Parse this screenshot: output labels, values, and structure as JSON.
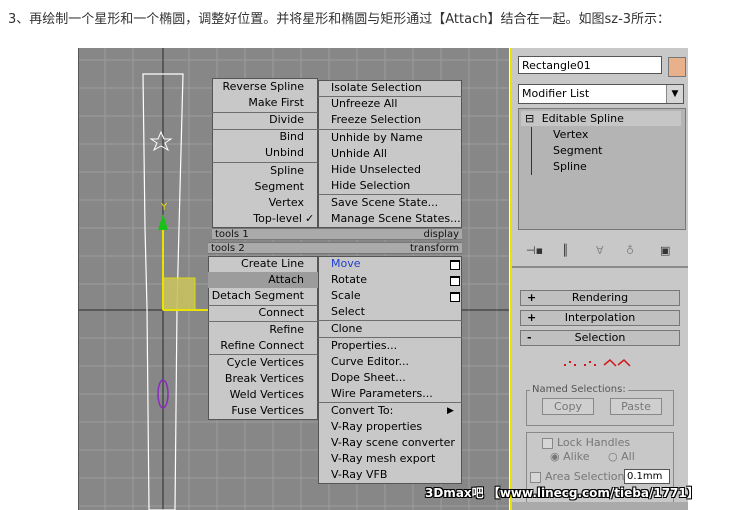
{
  "caption": "3、再绘制一个星形和一个椭圆，调整好位置。并将星形和椭圆与矩形通过【Attach】结合在一起。如图sz-3所示：",
  "viewport": {
    "axis_label": "Y"
  },
  "quad_left": {
    "header_tools1": "tools 1",
    "header_tools2": "tools 2",
    "items_top": [
      "Reverse Spline",
      "Make First",
      "Divide",
      "Bind",
      "Unbind",
      "Spline",
      "Segment",
      "Vertex",
      "Top-level"
    ],
    "items_bottom": [
      "Create Line",
      "Attach",
      "Detach Segment",
      "Connect",
      "Refine",
      "Refine Connect",
      "Cycle Vertices",
      "Break Vertices",
      "Weld Vertices",
      "Fuse Vertices"
    ],
    "checkmark": "✓"
  },
  "quad_right": {
    "header_display": "display",
    "header_transform": "transform",
    "items_top": [
      "Isolate Selection",
      "Unfreeze All",
      "Freeze Selection",
      "Unhide by Name",
      "Unhide All",
      "Hide Unselected",
      "Hide Selection",
      "Save Scene State...",
      "Manage Scene States..."
    ],
    "items_bottom": [
      "Move",
      "Rotate",
      "Scale",
      "Select",
      "Clone",
      "Properties...",
      "Curve Editor...",
      "Dope Sheet...",
      "Wire Parameters...",
      "Convert To:",
      "V-Ray properties",
      "V-Ray scene converter",
      "V-Ray mesh export",
      "V-Ray VFB"
    ]
  },
  "panel": {
    "object_name": "Rectangle01",
    "modifier_list": "Modifier List",
    "stack": {
      "root": "Editable Spline",
      "children": [
        "Vertex",
        "Segment",
        "Spline"
      ],
      "expander": "⊟"
    },
    "rollouts": [
      {
        "sign": "+",
        "label": "Rendering"
      },
      {
        "sign": "+",
        "label": "Interpolation"
      },
      {
        "sign": "-",
        "label": "Selection"
      }
    ],
    "named_selections": "Named Selections:",
    "copy": "Copy",
    "paste": "Paste",
    "lock_handles": "Lock Handles",
    "alike": "Alike",
    "all": "All",
    "area_selection": "Area Selection:",
    "area_value": "0.1mm"
  },
  "watermark": "3Dmax吧 【www.linecg.com/tieba/1771】",
  "colors": {
    "viewport_bg": "#878787",
    "accent_yellow": "#e8e400",
    "move_blue": "#1f3fd0",
    "swatch": "#e9b08c"
  }
}
